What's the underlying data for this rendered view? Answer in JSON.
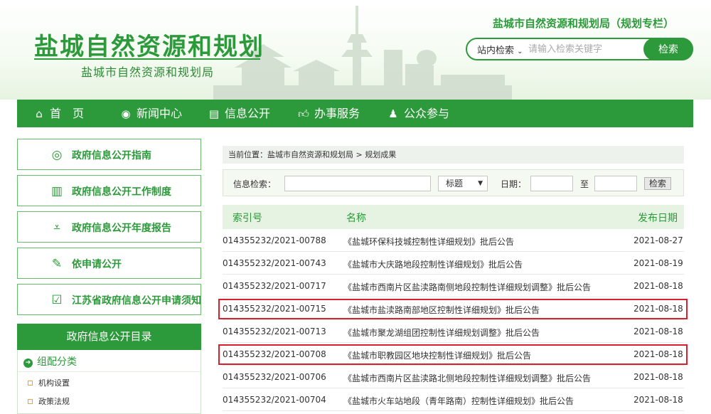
{
  "header": {
    "site_title": "盐城自然资源和规划",
    "site_subtitle": "盐城市自然资源和规划局",
    "special_title": "盐城市自然资源和规划局（规划专栏）",
    "search_scope": "站内检索",
    "search_placeholder": "请输入检索关键字",
    "search_button": "检索"
  },
  "nav": [
    {
      "label": "首　页",
      "icon": "home-icon"
    },
    {
      "label": "新闻中心",
      "icon": "globe-icon"
    },
    {
      "label": "信息公开",
      "icon": "document-icon"
    },
    {
      "label": "办事服务",
      "icon": "thumbs-up-icon"
    },
    {
      "label": "公众参与",
      "icon": "user-icon"
    }
  ],
  "sidebar": {
    "cards": [
      {
        "label": "政府信息公开指南",
        "icon": "compass-icon"
      },
      {
        "label": "政府信息公开工作制度",
        "icon": "document-list-icon"
      },
      {
        "label": "政府信息公开年度报告",
        "icon": "chart-report-icon"
      },
      {
        "label": "依申请公开",
        "icon": "application-form-icon"
      },
      {
        "label": "江苏省政府信息公开申请须知",
        "icon": "notice-icon"
      }
    ],
    "directory_title": "政府信息公开目录",
    "directory_category": "组配分类",
    "directory_items": [
      "机构设置",
      "政策法规"
    ]
  },
  "breadcrumb": "当前位置：盐城市自然资源和规划局 > 规划成果",
  "filter": {
    "search_label": "信息检索：",
    "field_select": "标题",
    "date_label": "日期：",
    "to_label": "至",
    "button": "检索"
  },
  "table": {
    "headers": [
      "索引号",
      "名称",
      "发布日期"
    ],
    "rows": [
      {
        "index": "014355232/2021-00788",
        "name": "《盐城环保科技城控制性详细规划》批后公告",
        "date": "2021-08-27"
      },
      {
        "index": "014355232/2021-00743",
        "name": "《盐城市大庆路地段控制性详细规划》批后公告",
        "date": "2021-08-19"
      },
      {
        "index": "014355232/2021-00717",
        "name": "《盐城市西南片区盐渎路南侧地段控制性详细规划调整》批后公告",
        "date": "2021-08-18"
      },
      {
        "index": "014355232/2021-00715",
        "name": "《盐城市盐渎路南部地区控制性详细规划》批后公告",
        "date": "2021-08-18"
      },
      {
        "index": "014355232/2021-00713",
        "name": "《盐城市聚龙湖组团控制性详细规划调整》批后公告",
        "date": "2021-08-18"
      },
      {
        "index": "014355232/2021-00708",
        "name": "《盐城市职教园区地块控制性详细规划》批后公告",
        "date": "2021-08-18"
      },
      {
        "index": "014355232/2021-00706",
        "name": "《盐城市西南片区盐渎路北侧地段控制性详细规划调整》批后公告",
        "date": "2021-08-18"
      },
      {
        "index": "014355232/2021-00704",
        "name": "《盐城市火车站地段（青年路南）控制性详细规划》批后公告",
        "date": "2021-08-18"
      }
    ]
  },
  "colors": {
    "brand_green": "#2c9a3a",
    "highlight_red": "#d62030"
  }
}
